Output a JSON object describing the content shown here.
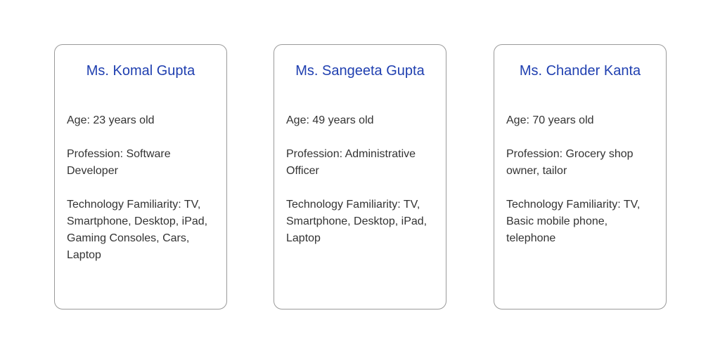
{
  "personas": [
    {
      "name": "Ms. Komal Gupta",
      "age": "Age: 23 years old",
      "profession": "Profession: Software Developer",
      "tech": "Technology Familiarity: TV, Smartphone, Desktop, iPad, Gaming Consoles, Cars, Laptop"
    },
    {
      "name": "Ms. Sangeeta Gupta",
      "age": "Age: 49 years old",
      "profession": "Profession: Administrative Officer",
      "tech": "Technology Familiarity: TV, Smartphone, Desktop, iPad, Laptop"
    },
    {
      "name": "Ms. Chander Kanta",
      "age": "Age: 70 years old",
      "profession": "Profession: Grocery shop owner, tailor",
      "tech": "Technology Familiarity: TV, Basic mobile phone, telephone"
    }
  ],
  "colors": {
    "name": "#1f3fb0",
    "text": "#333333",
    "border": "#9a9a9a"
  }
}
